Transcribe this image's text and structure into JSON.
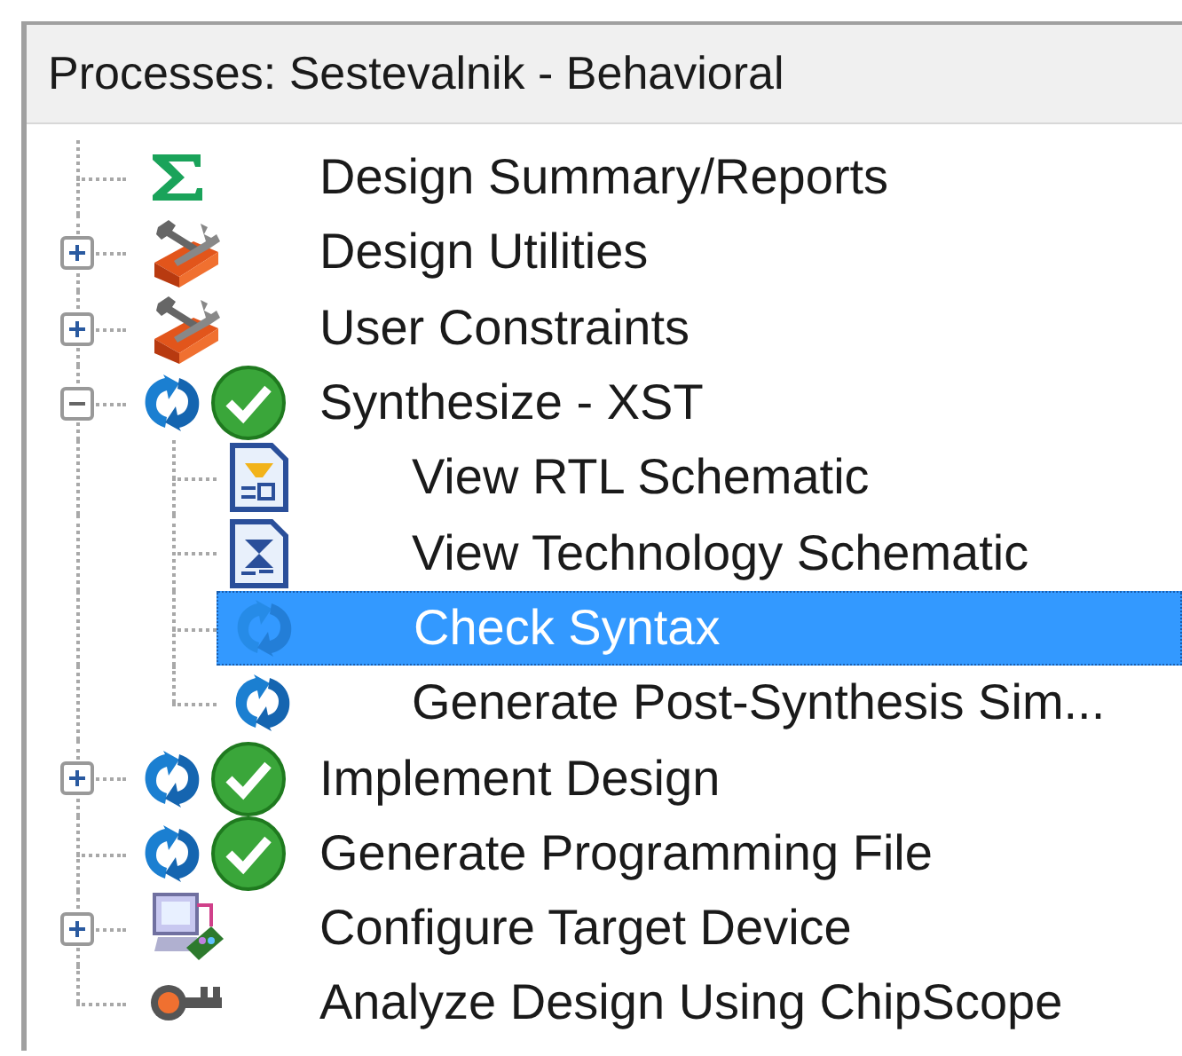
{
  "panel": {
    "title": "Processes: Sestevalnik - Behavioral"
  },
  "processes": [
    {
      "label": "Design Summary/Reports",
      "kind": "summary",
      "complete": false,
      "selected": false
    },
    {
      "label": "Design Utilities",
      "kind": "tools",
      "expanded": false,
      "complete": false,
      "selected": false
    },
    {
      "label": "User Constraints",
      "kind": "tools",
      "expanded": false,
      "complete": false,
      "selected": false
    },
    {
      "label": "Synthesize - XST",
      "kind": "process",
      "expanded": true,
      "complete": true,
      "selected": false,
      "children": [
        {
          "label": "View RTL Schematic",
          "kind": "rtl",
          "selected": false
        },
        {
          "label": "View Technology Schematic",
          "kind": "tech",
          "selected": false
        },
        {
          "label": "Check Syntax",
          "kind": "process",
          "selected": true
        },
        {
          "label": "Generate Post-Synthesis Sim...",
          "kind": "process",
          "selected": false
        }
      ]
    },
    {
      "label": "Implement Design",
      "kind": "process",
      "expanded": false,
      "complete": true,
      "selected": false
    },
    {
      "label": "Generate Programming File",
      "kind": "process",
      "complete": true,
      "selected": false
    },
    {
      "label": "Configure Target Device",
      "kind": "config",
      "expanded": false,
      "complete": false,
      "selected": false
    },
    {
      "label": "Analyze Design Using ChipScope",
      "kind": "chipscope",
      "complete": false,
      "selected": false
    }
  ]
}
